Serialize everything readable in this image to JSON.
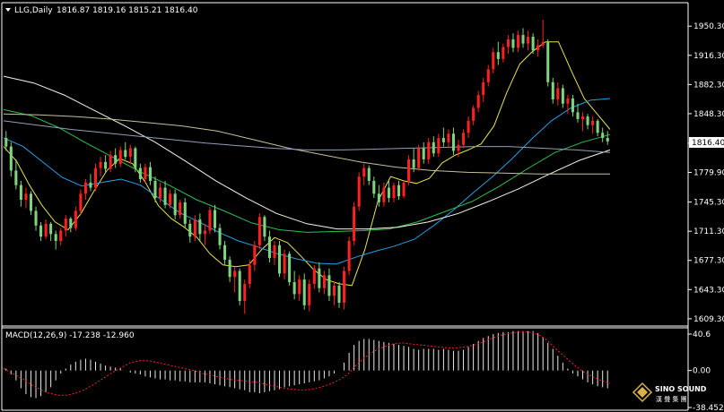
{
  "header": {
    "symbol": "LLG,Daily",
    "ohlc": "1816.87 1819.16 1815.21 1816.40",
    "macd_label": "MACD(12,26,9) -17.238 -12.960"
  },
  "current_price": "1816.40",
  "watermark": {
    "brand": "SINO SOUND",
    "sub": "漢 聲 集 團"
  },
  "colors": {
    "background": "#000000",
    "bull": "#ff2020",
    "bear": "#7fd47f",
    "ma_yellow": "#e8e24a",
    "ma_blue": "#2a9fe0",
    "ma_green": "#2fbf4f",
    "ma_white": "#f4f4e8",
    "ma_tan": "#c8bf9a",
    "ma_steel": "#8ea0b8",
    "macd_hist": "#e8e8e8",
    "macd_signal": "#ff2020"
  },
  "chart_data": [
    {
      "type": "candlestick",
      "title": "LLG,Daily",
      "y_ticks": [
        "1950.30",
        "1916.30",
        "1882.30",
        "1848.30",
        "1813.90",
        "1779.90",
        "1745.30",
        "1711.30",
        "1677.30",
        "1643.30",
        "1609.30"
      ],
      "ylim": [
        1605,
        1962
      ],
      "candles": [
        [
          1820,
          1828,
          1805,
          1810
        ],
        [
          1810,
          1815,
          1775,
          1782
        ],
        [
          1782,
          1795,
          1760,
          1765
        ],
        [
          1765,
          1770,
          1740,
          1748
        ],
        [
          1748,
          1762,
          1738,
          1755
        ],
        [
          1755,
          1758,
          1730,
          1735
        ],
        [
          1735,
          1740,
          1712,
          1718
        ],
        [
          1718,
          1722,
          1700,
          1705
        ],
        [
          1705,
          1725,
          1702,
          1720
        ],
        [
          1720,
          1722,
          1700,
          1708
        ],
        [
          1708,
          1712,
          1690,
          1700
        ],
        [
          1700,
          1715,
          1695,
          1712
        ],
        [
          1712,
          1730,
          1705,
          1726
        ],
        [
          1726,
          1728,
          1710,
          1715
        ],
        [
          1715,
          1740,
          1712,
          1735
        ],
        [
          1735,
          1760,
          1730,
          1755
        ],
        [
          1755,
          1772,
          1748,
          1768
        ],
        [
          1768,
          1778,
          1758,
          1762
        ],
        [
          1762,
          1790,
          1758,
          1785
        ],
        [
          1785,
          1798,
          1775,
          1792
        ],
        [
          1792,
          1800,
          1780,
          1784
        ],
        [
          1784,
          1805,
          1780,
          1800
        ],
        [
          1800,
          1808,
          1785,
          1790
        ],
        [
          1790,
          1810,
          1786,
          1806
        ],
        [
          1806,
          1815,
          1795,
          1798
        ],
        [
          1798,
          1812,
          1790,
          1808
        ],
        [
          1808,
          1810,
          1780,
          1785
        ],
        [
          1785,
          1790,
          1768,
          1772
        ],
        [
          1772,
          1790,
          1768,
          1786
        ],
        [
          1786,
          1792,
          1765,
          1770
        ],
        [
          1770,
          1775,
          1745,
          1750
        ],
        [
          1750,
          1768,
          1745,
          1762
        ],
        [
          1762,
          1770,
          1738,
          1742
        ],
        [
          1742,
          1760,
          1738,
          1755
        ],
        [
          1755,
          1760,
          1725,
          1730
        ],
        [
          1730,
          1748,
          1726,
          1745
        ],
        [
          1745,
          1750,
          1715,
          1720
        ],
        [
          1720,
          1725,
          1698,
          1705
        ],
        [
          1705,
          1730,
          1700,
          1725
        ],
        [
          1725,
          1732,
          1700,
          1708
        ],
        [
          1708,
          1720,
          1695,
          1712
        ],
        [
          1712,
          1740,
          1708,
          1736
        ],
        [
          1736,
          1742,
          1710,
          1715
        ],
        [
          1715,
          1720,
          1690,
          1695
        ],
        [
          1695,
          1700,
          1672,
          1678
        ],
        [
          1678,
          1682,
          1652,
          1658
        ],
        [
          1658,
          1670,
          1640,
          1665
        ],
        [
          1665,
          1668,
          1625,
          1630
        ],
        [
          1630,
          1655,
          1615,
          1650
        ],
        [
          1650,
          1678,
          1645,
          1672
        ],
        [
          1672,
          1700,
          1665,
          1695
        ],
        [
          1695,
          1732,
          1690,
          1728
        ],
        [
          1728,
          1730,
          1700,
          1705
        ],
        [
          1705,
          1712,
          1675,
          1680
        ],
        [
          1680,
          1700,
          1672,
          1695
        ],
        [
          1695,
          1700,
          1658,
          1662
        ],
        [
          1662,
          1690,
          1655,
          1685
        ],
        [
          1685,
          1688,
          1648,
          1652
        ],
        [
          1652,
          1665,
          1632,
          1638
        ],
        [
          1638,
          1660,
          1630,
          1655
        ],
        [
          1655,
          1662,
          1620,
          1625
        ],
        [
          1625,
          1655,
          1618,
          1650
        ],
        [
          1650,
          1672,
          1644,
          1668
        ],
        [
          1668,
          1675,
          1640,
          1645
        ],
        [
          1645,
          1665,
          1638,
          1660
        ],
        [
          1660,
          1668,
          1630,
          1636
        ],
        [
          1636,
          1652,
          1625,
          1648
        ],
        [
          1648,
          1652,
          1622,
          1628
        ],
        [
          1628,
          1670,
          1620,
          1665
        ],
        [
          1665,
          1705,
          1660,
          1700
        ],
        [
          1700,
          1745,
          1695,
          1740
        ],
        [
          1740,
          1780,
          1735,
          1775
        ],
        [
          1775,
          1790,
          1765,
          1785
        ],
        [
          1785,
          1788,
          1765,
          1770
        ],
        [
          1770,
          1775,
          1750,
          1755
        ],
        [
          1755,
          1765,
          1740,
          1745
        ],
        [
          1745,
          1768,
          1740,
          1762
        ],
        [
          1762,
          1770,
          1745,
          1750
        ],
        [
          1750,
          1768,
          1745,
          1765
        ],
        [
          1765,
          1770,
          1748,
          1752
        ],
        [
          1752,
          1770,
          1750,
          1768
        ],
        [
          1768,
          1800,
          1765,
          1795
        ],
        [
          1795,
          1808,
          1780,
          1785
        ],
        [
          1785,
          1812,
          1782,
          1808
        ],
        [
          1808,
          1815,
          1790,
          1795
        ],
        [
          1795,
          1820,
          1790,
          1815
        ],
        [
          1815,
          1822,
          1798,
          1802
        ],
        [
          1802,
          1825,
          1798,
          1820
        ],
        [
          1820,
          1832,
          1810,
          1815
        ],
        [
          1815,
          1830,
          1808,
          1825
        ],
        [
          1825,
          1832,
          1800,
          1805
        ],
        [
          1805,
          1818,
          1798,
          1812
        ],
        [
          1812,
          1830,
          1808,
          1826
        ],
        [
          1826,
          1845,
          1820,
          1840
        ],
        [
          1840,
          1858,
          1835,
          1855
        ],
        [
          1855,
          1875,
          1850,
          1870
        ],
        [
          1870,
          1890,
          1862,
          1885
        ],
        [
          1885,
          1905,
          1880,
          1900
        ],
        [
          1900,
          1925,
          1895,
          1920
        ],
        [
          1920,
          1932,
          1905,
          1912
        ],
        [
          1912,
          1930,
          1908,
          1926
        ],
        [
          1926,
          1940,
          1918,
          1935
        ],
        [
          1935,
          1942,
          1920,
          1925
        ],
        [
          1925,
          1945,
          1920,
          1940
        ],
        [
          1940,
          1948,
          1925,
          1930
        ],
        [
          1930,
          1945,
          1922,
          1938
        ],
        [
          1938,
          1942,
          1918,
          1922
        ],
        [
          1922,
          1935,
          1915,
          1928
        ],
        [
          1928,
          1958,
          1925,
          1932
        ],
        [
          1932,
          1935,
          1880,
          1885
        ],
        [
          1885,
          1890,
          1860,
          1865
        ],
        [
          1865,
          1885,
          1858,
          1878
        ],
        [
          1878,
          1882,
          1855,
          1860
        ],
        [
          1860,
          1870,
          1848,
          1866
        ],
        [
          1866,
          1870,
          1845,
          1850
        ],
        [
          1850,
          1860,
          1838,
          1842
        ],
        [
          1842,
          1850,
          1828,
          1845
        ],
        [
          1845,
          1848,
          1830,
          1835
        ],
        [
          1835,
          1845,
          1825,
          1840
        ],
        [
          1840,
          1842,
          1822,
          1826
        ],
        [
          1826,
          1832,
          1815,
          1820
        ],
        [
          1820,
          1828,
          1812,
          1816
        ]
      ],
      "moving_averages": [
        {
          "color_key": "ma_yellow",
          "values": [
            1810,
            1793,
            1765,
            1741,
            1722,
            1713,
            1732,
            1758,
            1782,
            1796,
            1790,
            1768,
            1741,
            1726,
            1716,
            1704,
            1685,
            1672,
            1670,
            1672,
            1690,
            1704,
            1698,
            1683,
            1667,
            1655,
            1650,
            1648,
            1690,
            1746,
            1775,
            1770,
            1767,
            1773,
            1791,
            1800,
            1806,
            1813,
            1834,
            1873,
            1906,
            1921,
            1932,
            1932,
            1898,
            1866,
            1848,
            1830
          ]
        },
        {
          "color_key": "ma_blue",
          "values": [
            1820,
            1810,
            1792,
            1774,
            1764,
            1768,
            1772,
            1765,
            1749,
            1733,
            1722,
            1710,
            1700,
            1693,
            1685,
            1679,
            1674,
            1673,
            1681,
            1688,
            1694,
            1702,
            1718,
            1736,
            1756,
            1775,
            1796,
            1819,
            1840,
            1855,
            1864,
            1866
          ]
        },
        {
          "color_key": "ma_green",
          "values": [
            1853,
            1846,
            1832,
            1814,
            1797,
            1780,
            1765,
            1748,
            1735,
            1721,
            1713,
            1710,
            1711,
            1712,
            1714,
            1722,
            1734,
            1746,
            1764,
            1784,
            1803,
            1815,
            1824
          ]
        },
        {
          "color_key": "ma_white",
          "values": [
            1892,
            1884,
            1870,
            1852,
            1834,
            1815,
            1793,
            1770,
            1750,
            1732,
            1720,
            1714,
            1714,
            1716,
            1722,
            1732,
            1746,
            1761,
            1778,
            1794,
            1806
          ]
        },
        {
          "color_key": "ma_tan",
          "values": [
            1848,
            1847,
            1845,
            1842,
            1838,
            1834,
            1828,
            1818,
            1808,
            1800,
            1792,
            1786,
            1782,
            1780,
            1779,
            1778,
            1778,
            1778
          ]
        },
        {
          "color_key": "ma_steel",
          "values": [
            1840,
            1835,
            1830,
            1826,
            1822,
            1818,
            1814,
            1811,
            1808,
            1806,
            1806,
            1807,
            1808,
            1809,
            1810,
            1810,
            1808,
            1806,
            1803
          ]
        }
      ]
    },
    {
      "type": "bar",
      "title": "MACD(12,26,9) -17.238 -12.960",
      "y_ticks": [
        "40.6",
        "0.00",
        "-38.452"
      ],
      "ylim": [
        -38.452,
        40.6
      ],
      "histogram": [
        2,
        -4,
        -10,
        -18,
        -24,
        -27,
        -28,
        -26,
        -22,
        -17,
        -10,
        -3,
        2,
        6,
        9,
        11,
        12,
        11,
        9,
        7,
        5,
        4,
        3,
        2,
        0,
        -2,
        -3,
        -4,
        -6,
        -7,
        -8,
        -9,
        -9,
        -10,
        -10,
        -11,
        -11,
        -12,
        -12,
        -12,
        -12,
        -13,
        -14,
        -15,
        -16,
        -17,
        -18,
        -19,
        -20,
        -22,
        -22,
        -23,
        -22,
        -21,
        -20,
        -19,
        -17,
        -16,
        -15,
        -14,
        -13,
        -12,
        -11,
        -10,
        -8,
        -6,
        -3,
        0,
        8,
        18,
        26,
        30,
        32,
        32,
        31,
        30,
        29,
        28,
        27,
        26,
        25,
        24,
        22,
        21,
        22,
        22,
        22,
        21,
        22,
        21,
        20,
        20,
        21,
        24,
        27,
        30,
        33,
        35,
        37,
        38,
        39,
        39,
        40,
        40,
        40,
        40,
        40,
        38,
        34,
        28,
        22,
        15,
        8,
        2,
        -3,
        -6,
        -9,
        -12,
        -14,
        -16,
        -17,
        -18
      ],
      "signal": [
        2,
        -3,
        -8,
        -14,
        -19,
        -23,
        -25,
        -25,
        -23,
        -19,
        -14,
        -8,
        -2,
        3,
        8,
        10,
        10,
        8,
        6,
        4,
        2,
        0,
        -3,
        -5,
        -7,
        -9,
        -10,
        -11,
        -12,
        -14,
        -16,
        -18,
        -19,
        -20,
        -19,
        -17,
        -14,
        -10,
        -4,
        6,
        14,
        20,
        24,
        27,
        28,
        27,
        26,
        25,
        24,
        23,
        23,
        24,
        26,
        29,
        33,
        36,
        38,
        39,
        39,
        37,
        31,
        22,
        14,
        6,
        -1,
        -6,
        -10,
        -13
      ]
    }
  ]
}
